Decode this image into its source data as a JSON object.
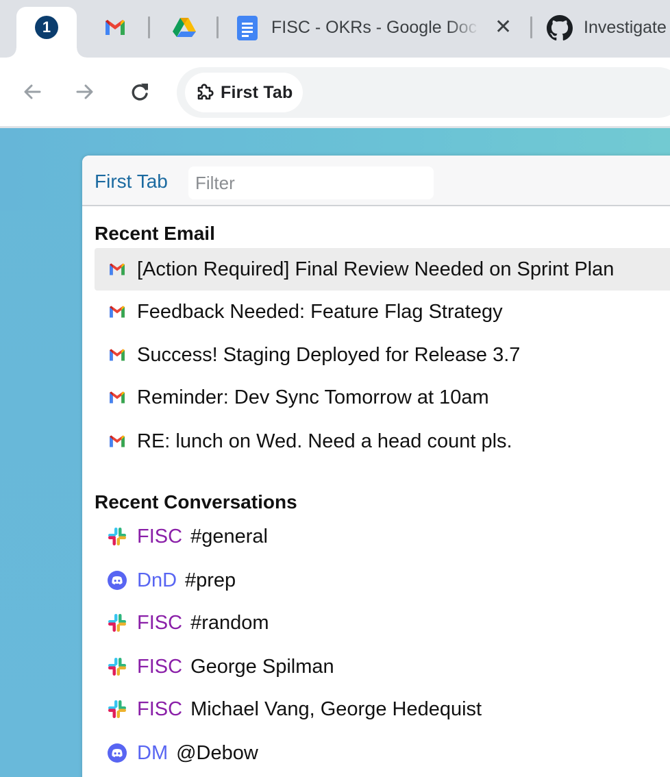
{
  "browser": {
    "tabs": [
      {
        "kind": "pinned",
        "badge": "1"
      },
      {
        "kind": "gmail"
      },
      {
        "kind": "drive"
      },
      {
        "kind": "docs",
        "title": "FISC - OKRs - Google Doc"
      },
      {
        "kind": "github",
        "title": "Investigate"
      }
    ],
    "address_chip": "First Tab"
  },
  "panel": {
    "title": "First Tab",
    "filter_placeholder": "Filter",
    "sections": {
      "email": {
        "title": "Recent Email",
        "items": [
          "[Action Required] Final Review Needed on Sprint Plan",
          "Feedback Needed: Feature Flag Strategy",
          "Success! Staging Deployed for Release 3.7",
          "Reminder: Dev Sync Tomorrow at 10am",
          "RE: lunch on Wed. Need a head count pls."
        ]
      },
      "conversations": {
        "title": "Recent Conversations",
        "items": [
          {
            "app": "slack",
            "workspace": "FISC",
            "channel": "#general"
          },
          {
            "app": "discord",
            "workspace": "DnD",
            "channel": "#prep"
          },
          {
            "app": "slack",
            "workspace": "FISC",
            "channel": "#random"
          },
          {
            "app": "slack",
            "workspace": "FISC",
            "channel": "George Spilman"
          },
          {
            "app": "slack",
            "workspace": "FISC",
            "channel": "Michael Vang, George Hedequist"
          },
          {
            "app": "discord",
            "workspace": "DM",
            "channel": "@Debow"
          }
        ]
      }
    }
  },
  "colors": {
    "slack_workspace": "#8a1fa8",
    "discord_workspace": "#5865f2",
    "panel_title": "#1b6aa0",
    "page_background": "#67b8d8"
  }
}
